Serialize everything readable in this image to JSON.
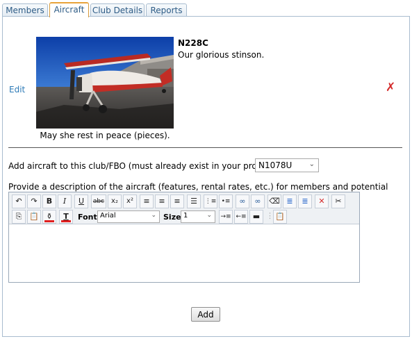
{
  "tabs": [
    {
      "label": "Members",
      "active": false
    },
    {
      "label": "Aircraft",
      "active": true
    },
    {
      "label": "Club Details",
      "active": false
    },
    {
      "label": "Reports",
      "active": false
    }
  ],
  "aircraft": {
    "edit_label": "Edit",
    "delete_icon": "close-icon",
    "tail_number": "N228C",
    "description": "Our glorious stinson.",
    "photo_caption": "May she rest in peace (pieces)."
  },
  "add_form": {
    "label": "Add aircraft to this club/FBO (must already exist in your profile):",
    "selected_aircraft": "N1078U",
    "description_label": "Provide a description of the aircraft (features, rental rates, etc.) for members and potential members:",
    "font_label": "Font",
    "font_value": "Arial",
    "size_label": "Size",
    "size_value": "1",
    "editor_content": "",
    "add_button": "Add"
  },
  "toolbar_icons": {
    "row1": [
      "undo-icon",
      "redo-icon",
      "bold-icon",
      "italic-icon",
      "underline-icon",
      "strikethrough-icon",
      "subscript-icon",
      "superscript-icon",
      "align-left-icon",
      "align-center-icon",
      "align-right-icon",
      "justify-icon",
      "ordered-list-icon",
      "unordered-list-icon",
      "insert-link-icon",
      "remove-link-icon",
      "eraser-icon",
      "format-block-icon",
      "clear-format-icon",
      "delete-icon",
      "cut-icon"
    ],
    "row2": [
      "copy-icon",
      "paste-icon",
      "highlight-color-icon",
      "text-color-icon",
      "indent-icon",
      "outdent-icon",
      "horizontal-rule-icon",
      "paste-text-icon"
    ]
  },
  "colors": {
    "tab_text": "#2e5c86",
    "tab_active_border": "#e8a33a",
    "link": "#2e7bb7",
    "delete": "#d42a2a"
  }
}
